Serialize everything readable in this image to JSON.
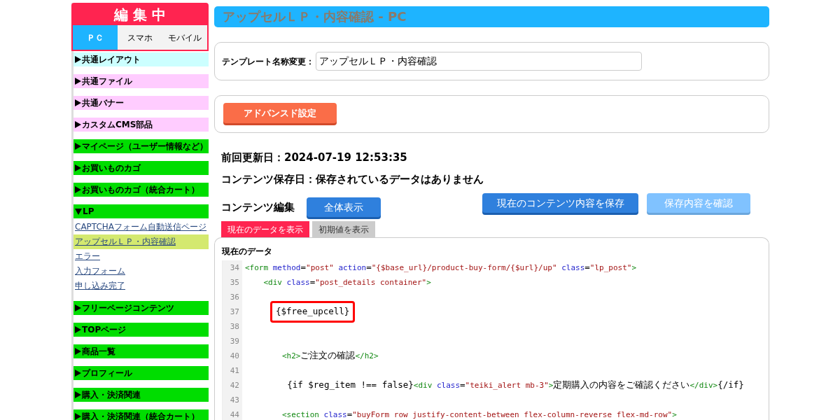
{
  "sidebar": {
    "title": "編 集 中",
    "modes": [
      {
        "label": "ＰＣ",
        "selected": true
      },
      {
        "label": "スマホ",
        "selected": false
      },
      {
        "label": "モバイル",
        "selected": false
      }
    ],
    "items": [
      {
        "label": "共通レイアウト",
        "color": "#ccffff",
        "expanded": false
      },
      {
        "label": "共通ファイル",
        "color": "#ffccff",
        "expanded": false
      },
      {
        "label": "共通バナー",
        "color": "#ffccff",
        "expanded": false
      },
      {
        "label": "カスタムCMS部品",
        "color": "#ffccff",
        "expanded": false
      },
      {
        "label": "マイページ（ユーザー情報など）",
        "color": "#00dd00",
        "expanded": false
      },
      {
        "label": "お買いものカゴ",
        "color": "#00dd00",
        "expanded": false
      },
      {
        "label": "お買いものカゴ（統合カート）",
        "color": "#00dd00",
        "expanded": false
      },
      {
        "label": "LP",
        "color": "#00dd00",
        "expanded": true,
        "children": [
          {
            "label": "CAPTCHAフォーム自動送信ページ",
            "selected": false
          },
          {
            "label": "アップセルＬＰ・内容確認",
            "selected": true
          },
          {
            "label": "エラー",
            "selected": false
          },
          {
            "label": "入力フォーム",
            "selected": false
          },
          {
            "label": "申し込み完了",
            "selected": false
          }
        ]
      },
      {
        "label": "フリーページコンテンツ",
        "color": "#00dd00",
        "expanded": false
      },
      {
        "label": "TOPページ",
        "color": "#00dd00",
        "expanded": false
      },
      {
        "label": "商品一覧",
        "color": "#00dd00",
        "expanded": false
      },
      {
        "label": "プロフィール",
        "color": "#00dd00",
        "expanded": false
      },
      {
        "label": "購入・決済関連",
        "color": "#00dd00",
        "expanded": false
      },
      {
        "label": "購入・決済関連（統合カート）",
        "color": "#00dd00",
        "expanded": false
      }
    ]
  },
  "page_title": "アップセルＬＰ・内容確認 - PC",
  "template_name": {
    "label": "テンプレート名称変更：",
    "value": "アップセルＬＰ・内容確認"
  },
  "advanced_button": "アドバンスド設定",
  "last_updated": "前回更新日：2024-07-19 12:53:35",
  "content_saved": "コンテンツ保存日：保存されているデータはありません",
  "editor": {
    "heading": "コンテンツ編集",
    "full_view_button": "全体表示",
    "save_button": "現在のコンテンツ内容を保存",
    "check_button": {
      "label": "保存内容を確認",
      "disabled": true
    },
    "tabs": [
      {
        "label": "現在のデータを表示",
        "selected": true
      },
      {
        "label": "初期値を表示",
        "selected": false
      }
    ],
    "panel_title": "現在のデータ",
    "lines": [
      {
        "number": "34",
        "highlighted": false,
        "tokens": [
          {
            "kind": "tag",
            "text": "<form"
          },
          {
            "kind": "attr",
            "text": " method"
          },
          {
            "kind": "plain",
            "text": "="
          },
          {
            "kind": "str",
            "text": "\"post\""
          },
          {
            "kind": "attr",
            "text": " action"
          },
          {
            "kind": "plain",
            "text": "="
          },
          {
            "kind": "str",
            "text": "\"{$base_url}/product-buy-form/{$url}/up\""
          },
          {
            "kind": "attr",
            "text": " class"
          },
          {
            "kind": "plain",
            "text": "="
          },
          {
            "kind": "str",
            "text": "\"lp_post\""
          },
          {
            "kind": "tag",
            "text": ">"
          }
        ]
      },
      {
        "number": "35",
        "highlighted": false,
        "tokens": [
          {
            "kind": "tag",
            "text": "    <div"
          },
          {
            "kind": "attr",
            "text": " class"
          },
          {
            "kind": "plain",
            "text": "="
          },
          {
            "kind": "str",
            "text": "\"post_details container\""
          },
          {
            "kind": "tag",
            "text": ">"
          }
        ]
      },
      {
        "number": "36",
        "highlighted": false
      },
      {
        "number": "37",
        "highlighted": true,
        "tokens": [
          {
            "kind": "plain",
            "text": "{$free_upcell}"
          }
        ]
      },
      {
        "number": "38",
        "highlighted": false
      },
      {
        "number": "39",
        "highlighted": false
      },
      {
        "number": "40",
        "highlighted": false,
        "tokens": [
          {
            "kind": "tag",
            "text": "        <h2>"
          },
          {
            "kind": "plain",
            "text": "ご注文の確認"
          },
          {
            "kind": "tag",
            "text": "</h2>"
          }
        ]
      },
      {
        "number": "41",
        "highlighted": false
      },
      {
        "number": "42",
        "highlighted": false,
        "tokens": [
          {
            "kind": "plain",
            "text": "        {if $reg_item !== false}"
          },
          {
            "kind": "tag",
            "text": "<div"
          },
          {
            "kind": "attr",
            "text": " class"
          },
          {
            "kind": "plain",
            "text": "="
          },
          {
            "kind": "str",
            "text": "\"teiki_alert mb-3\""
          },
          {
            "kind": "tag",
            "text": ">"
          },
          {
            "kind": "plain",
            "text": "定期購入の内容をご確認ください"
          },
          {
            "kind": "tag",
            "text": "</div>"
          },
          {
            "kind": "plain",
            "text": "{/if}"
          }
        ]
      },
      {
        "number": "43",
        "highlighted": false
      },
      {
        "number": "44",
        "highlighted": false,
        "tokens": [
          {
            "kind": "tag",
            "text": "        <section"
          },
          {
            "kind": "attr",
            "text": " class"
          },
          {
            "kind": "plain",
            "text": "="
          },
          {
            "kind": "str",
            "text": "\"buyForm row justify-content-between flex-column-reverse flex-md-row\""
          },
          {
            "kind": "tag",
            "text": ">"
          }
        ]
      }
    ]
  }
}
